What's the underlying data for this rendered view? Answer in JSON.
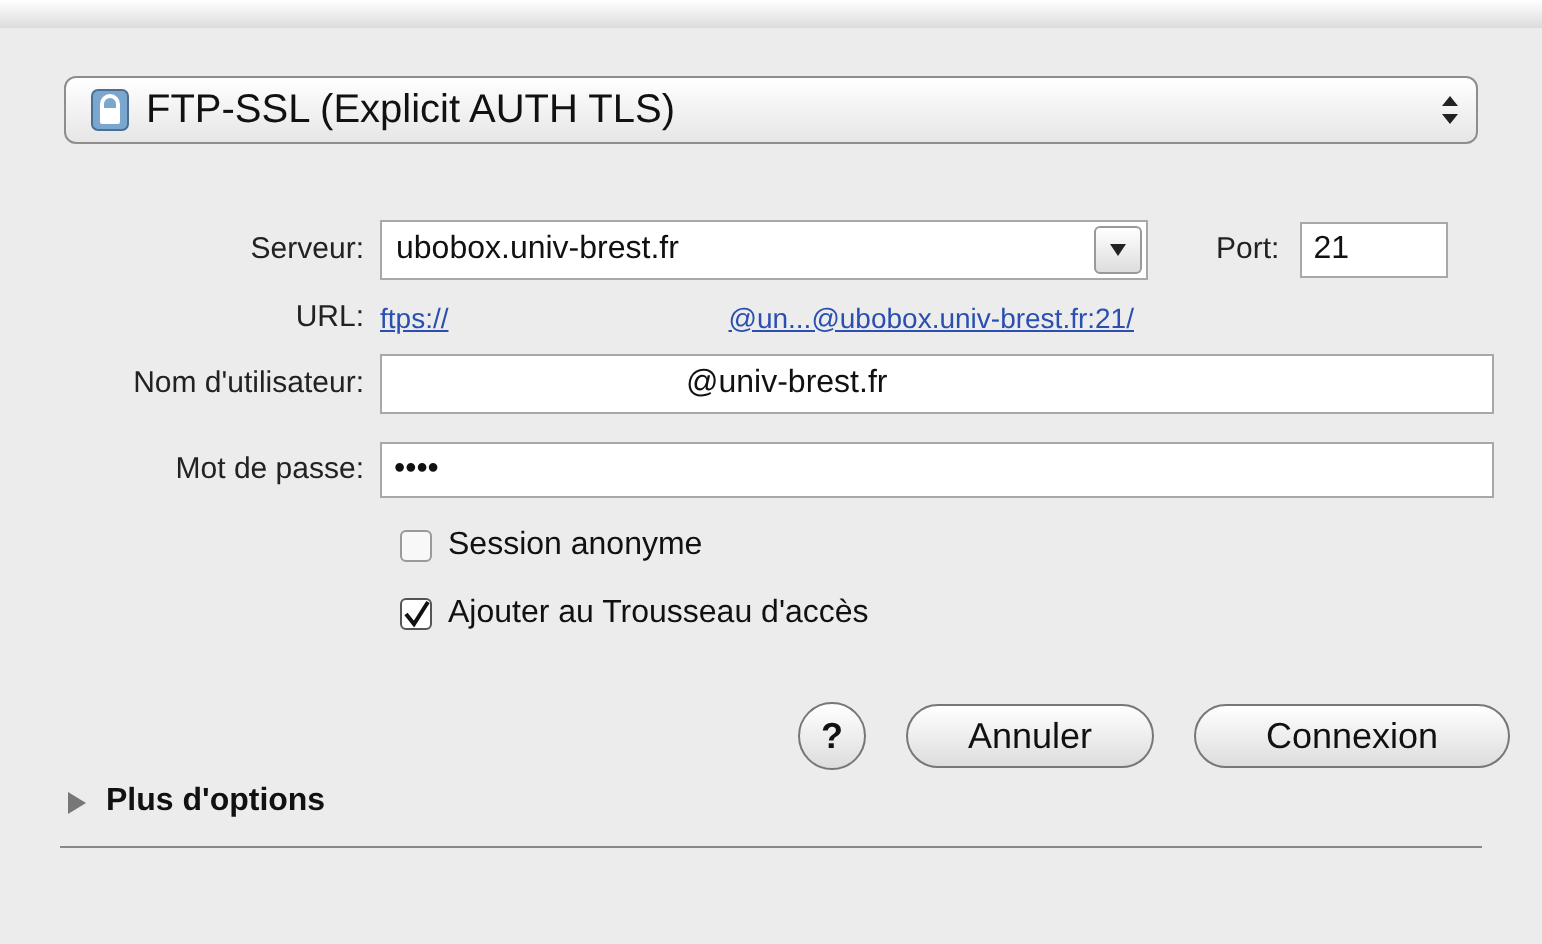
{
  "protocol": {
    "label": "FTP-SSL (Explicit AUTH TLS)"
  },
  "server": {
    "label": "Serveur:",
    "value": "ubobox.univ-brest.fr"
  },
  "port": {
    "label": "Port:",
    "value": "21"
  },
  "url": {
    "label": "URL:",
    "scheme": "ftps://",
    "address": "@un...@ubobox.univ-brest.fr:21/"
  },
  "username": {
    "label": "Nom d'utilisateur:",
    "value": "@univ-brest.fr"
  },
  "password": {
    "label": "Mot de passe:",
    "value": "••••"
  },
  "options": [
    {
      "label": "Session anonyme",
      "checked": false
    },
    {
      "label": "Ajouter au Trousseau d'accès",
      "checked": true
    }
  ],
  "help_button": {
    "label": "?"
  },
  "buttons": [
    {
      "label": "Annuler",
      "default": false
    },
    {
      "label": "Connexion",
      "default": false
    }
  ],
  "disclosure": {
    "label": "Plus d'options",
    "expanded": false
  }
}
